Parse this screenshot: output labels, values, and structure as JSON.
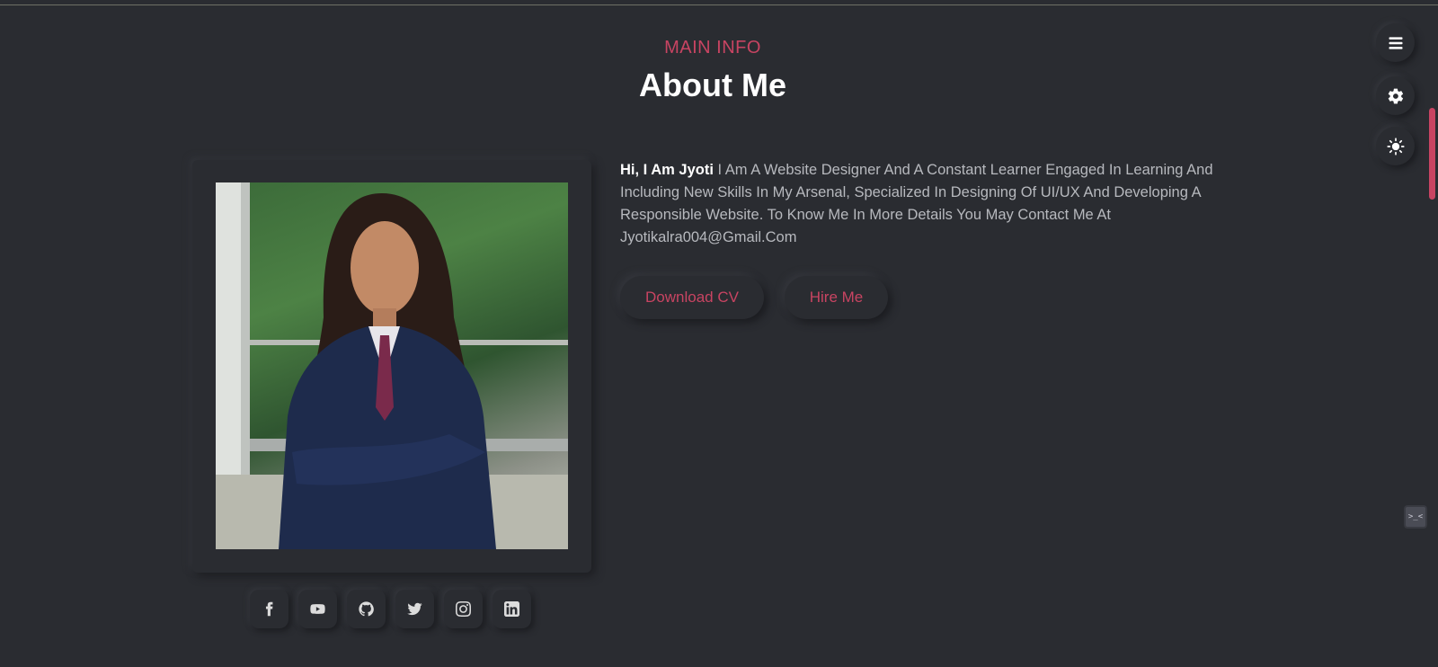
{
  "section": {
    "eyebrow": "MAIN INFO",
    "title": "About Me"
  },
  "bio": {
    "greeting": "Hi, I Am Jyoti",
    "text": " I Am A Website Designer And A Constant Learner Engaged In Learning And Including New Skills In My Arsenal, Specialized In Designing Of UI/UX And Developing A Responsible Website. To Know Me In More Details You May Contact Me At Jyotikalra004@Gmail.Com"
  },
  "buttons": {
    "download": "Download CV",
    "hire": "Hire Me"
  },
  "socials": [
    {
      "icon": "facebook-icon"
    },
    {
      "icon": "youtube-icon"
    },
    {
      "icon": "github-icon"
    },
    {
      "icon": "twitter-icon"
    },
    {
      "icon": "instagram-icon"
    },
    {
      "icon": "linkedin-icon"
    }
  ],
  "side_controls": [
    {
      "icon": "menu-icon"
    },
    {
      "icon": "settings-icon"
    },
    {
      "icon": "theme-toggle-icon"
    }
  ],
  "terminal_widget": {
    "label": ">_<"
  },
  "colors": {
    "background": "#2a2c31",
    "accent": "#c84462",
    "text": "#b7b9be",
    "heading": "#ffffff"
  }
}
